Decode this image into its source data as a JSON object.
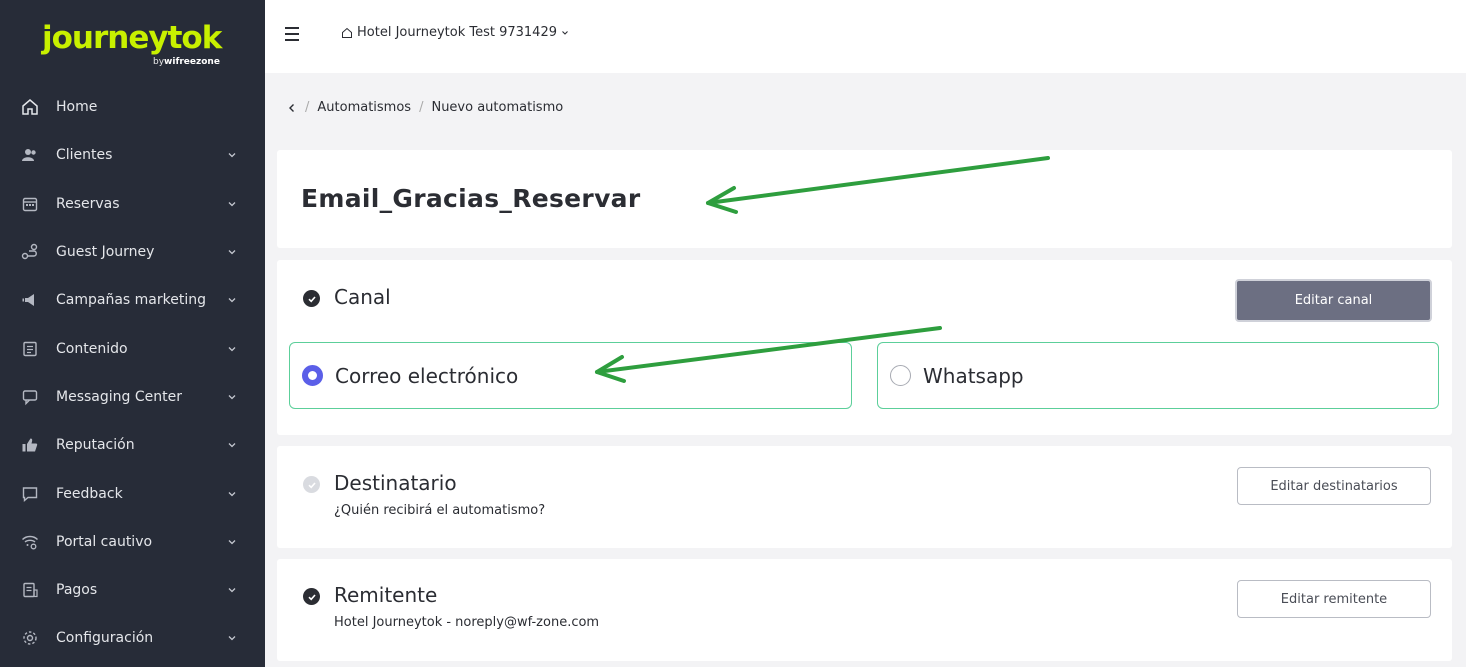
{
  "brand": {
    "logo": "journeytok",
    "byline_prefix": "by",
    "byline_brand": "wifreezone"
  },
  "sidebar": {
    "items": [
      {
        "label": "Home",
        "icon": "home-icon"
      },
      {
        "label": "Clientes",
        "icon": "users-icon"
      },
      {
        "label": "Reservas",
        "icon": "calendar-icon"
      },
      {
        "label": "Guest Journey",
        "icon": "route-icon"
      },
      {
        "label": "Campañas marketing",
        "icon": "megaphone-icon"
      },
      {
        "label": "Contenido",
        "icon": "document-icon"
      },
      {
        "label": "Messaging Center",
        "icon": "chat-icon"
      },
      {
        "label": "Reputación",
        "icon": "thumbs-up-icon"
      },
      {
        "label": "Feedback",
        "icon": "comment-icon"
      },
      {
        "label": "Portal cautivo",
        "icon": "wifi-gear-icon"
      },
      {
        "label": "Pagos",
        "icon": "receipt-icon"
      },
      {
        "label": "Configuración",
        "icon": "gear-icon"
      }
    ]
  },
  "topbar": {
    "hotel": "Hotel Journeytok Test 9731429"
  },
  "breadcrumb": {
    "items": [
      "Automatismos",
      "Nuevo automatismo"
    ]
  },
  "automation": {
    "name": "Email_Gracias_Reservar"
  },
  "canal": {
    "title": "Canal",
    "edit_label": "Editar canal",
    "options": [
      {
        "label": "Correo electrónico",
        "selected": true
      },
      {
        "label": "Whatsapp",
        "selected": false
      }
    ]
  },
  "destinatario": {
    "title": "Destinatario",
    "subtitle": "¿Quién recibirá el automatismo?",
    "edit_label": "Editar destinatarios"
  },
  "remitente": {
    "title": "Remitente",
    "subtitle": "Hotel Journeytok - noreply@wf-zone.com",
    "edit_label": "Editar remitente"
  },
  "colors": {
    "sidebar_bg": "#272c38",
    "brand_lime": "#c8f000",
    "radio_selected": "#5b5fe8",
    "option_border": "#5ccf9a",
    "annotation_arrow": "#2e9e3e",
    "button_dark": "#6c6f82"
  }
}
